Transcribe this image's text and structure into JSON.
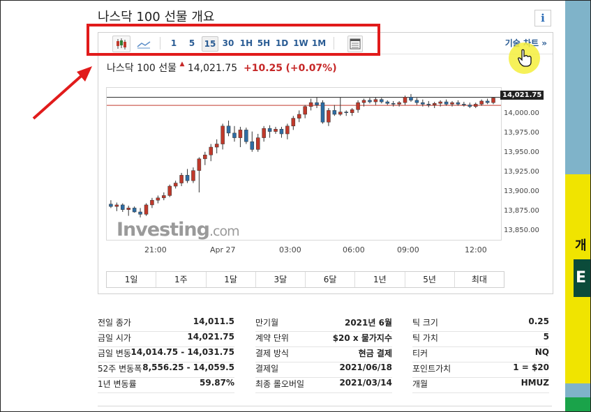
{
  "page": {
    "title": "나스닥 100 선물 개요",
    "info_label": "i"
  },
  "toolbar": {
    "timeframes": [
      "1",
      "5",
      "15",
      "30",
      "1H",
      "5H",
      "1D",
      "1W",
      "1M"
    ],
    "active": "15",
    "tech_chart_link": "기술 차트 »"
  },
  "quote": {
    "name": "나스닥 100 선물",
    "price": "14,021.75",
    "change": "+10.25",
    "change_pct": "(+0.07%)"
  },
  "chart_data": {
    "type": "candlestick",
    "y_ticks": [
      "14,000.00",
      "13,975.00",
      "13,950.00",
      "13,925.00",
      "13,900.00",
      "13,875.00",
      "13,850.00"
    ],
    "ylim": [
      13850,
      14025
    ],
    "x_ticks": [
      "21:00",
      "Apr 27",
      "03:00",
      "06:00",
      "09:00",
      "12:00"
    ],
    "last_price_label": "14,021.75",
    "reference_line": 14011.5,
    "candles": [
      [
        13885,
        13890,
        13880,
        13882
      ],
      [
        13882,
        13887,
        13876,
        13884
      ],
      [
        13884,
        13886,
        13875,
        13878
      ],
      [
        13878,
        13883,
        13870,
        13880
      ],
      [
        13880,
        13882,
        13874,
        13875
      ],
      [
        13875,
        13880,
        13868,
        13872
      ],
      [
        13872,
        13886,
        13870,
        13884
      ],
      [
        13884,
        13893,
        13880,
        13890
      ],
      [
        13890,
        13896,
        13886,
        13893
      ],
      [
        13893,
        13900,
        13890,
        13896
      ],
      [
        13896,
        13910,
        13894,
        13908
      ],
      [
        13908,
        13915,
        13905,
        13912
      ],
      [
        13912,
        13925,
        13908,
        13922
      ],
      [
        13922,
        13930,
        13912,
        13915
      ],
      [
        13915,
        13932,
        13912,
        13928
      ],
      [
        13928,
        13945,
        13900,
        13943
      ],
      [
        13943,
        13952,
        13935,
        13948
      ],
      [
        13948,
        13962,
        13940,
        13958
      ],
      [
        13958,
        13968,
        13950,
        13962
      ],
      [
        13962,
        13988,
        13955,
        13985
      ],
      [
        13985,
        13992,
        13972,
        13976
      ],
      [
        13976,
        13985,
        13965,
        13970
      ],
      [
        13970,
        13984,
        13958,
        13980
      ],
      [
        13980,
        13983,
        13962,
        13965
      ],
      [
        13965,
        13978,
        13952,
        13955
      ],
      [
        13955,
        13975,
        13952,
        13970
      ],
      [
        13970,
        13985,
        13965,
        13982
      ],
      [
        13982,
        13986,
        13970,
        13978
      ],
      [
        13978,
        13984,
        13975,
        13981
      ],
      [
        13981,
        13984,
        13970,
        13975
      ],
      [
        13975,
        13988,
        13968,
        13985
      ],
      [
        13985,
        13998,
        13980,
        13995
      ],
      [
        13995,
        14005,
        13990,
        14000
      ],
      [
        14000,
        14012,
        13995,
        14010
      ],
      [
        14010,
        14020,
        14005,
        14015
      ],
      [
        14015,
        14022,
        14008,
        14012
      ],
      [
        14015,
        14018,
        13988,
        13990
      ],
      [
        13990,
        14008,
        13985,
        14005
      ],
      [
        14005,
        14012,
        13998,
        14000
      ],
      [
        14000,
        14022,
        13998,
        14003
      ],
      [
        14003,
        14005,
        13998,
        14002
      ],
      [
        14002,
        14008,
        13998,
        14006
      ],
      [
        14006,
        14018,
        14002,
        14015
      ],
      [
        14015,
        14020,
        14010,
        14018
      ],
      [
        14018,
        14021,
        14014,
        14016
      ],
      [
        14016,
        14022,
        14012,
        14019
      ],
      [
        14019,
        14021,
        14014,
        14016
      ],
      [
        14016,
        14018,
        14012,
        14014
      ],
      [
        14014,
        14017,
        14010,
        14013
      ],
      [
        14013,
        14017,
        14010,
        14015
      ],
      [
        14015,
        14024,
        14012,
        14022
      ],
      [
        14022,
        14026,
        14016,
        14018
      ],
      [
        14018,
        14021,
        14012,
        14015
      ],
      [
        14015,
        14019,
        14010,
        14013
      ],
      [
        14013,
        14017,
        14009,
        14012
      ],
      [
        14012,
        14016,
        14008,
        14014
      ],
      [
        14014,
        14018,
        14010,
        14016
      ],
      [
        14016,
        14019,
        14011,
        14013
      ],
      [
        14013,
        14017,
        14010,
        14015
      ],
      [
        14015,
        14018,
        14011,
        14013
      ],
      [
        14013,
        14016,
        14010,
        14012
      ],
      [
        14012,
        14015,
        14008,
        14010
      ],
      [
        14010,
        14015,
        14008,
        14013
      ],
      [
        14013,
        14019,
        14011,
        14017
      ],
      [
        14017,
        14020,
        14013,
        14015
      ],
      [
        14015,
        14022,
        14013,
        14021
      ]
    ]
  },
  "periods": [
    "1일",
    "1주",
    "1달",
    "3달",
    "6달",
    "1년",
    "5년",
    "최대"
  ],
  "watermark": {
    "main": "Investing",
    "suffix": ".com"
  },
  "stats": {
    "col1": [
      {
        "k": "전일 종가",
        "v": "14,011.5"
      },
      {
        "k": "금일 시가",
        "v": "14,021.75"
      },
      {
        "k": "금일 변동",
        "v": "14,014.75 - 14,031.75"
      },
      {
        "k": "52주 변동폭",
        "v": "8,556.25 - 14,059.5"
      },
      {
        "k": "1년 변동률",
        "v": "59.87%"
      }
    ],
    "col2": [
      {
        "k": "만기월",
        "v": "2021년 6월"
      },
      {
        "k": "계약 단위",
        "v": "$20 x 물가지수"
      },
      {
        "k": "결제 방식",
        "v": "현금 결제"
      },
      {
        "k": "결제일",
        "v": "2021/06/18"
      },
      {
        "k": "최종 롤오버일",
        "v": "2021/03/14"
      }
    ],
    "col3": [
      {
        "k": "틱 크기",
        "v": "0.25"
      },
      {
        "k": "틱 가치",
        "v": "5"
      },
      {
        "k": "티커",
        "v": "NQ"
      },
      {
        "k": "포인트가치",
        "v": "1 = $20"
      },
      {
        "k": "개월",
        "v": "HMUZ"
      }
    ]
  },
  "side_ad": {
    "text1": "개",
    "text2": "E"
  },
  "colors": {
    "up": "#c0392b",
    "down": "#2e6da4",
    "accent": "#e11b1b",
    "link": "#2a5c94"
  }
}
